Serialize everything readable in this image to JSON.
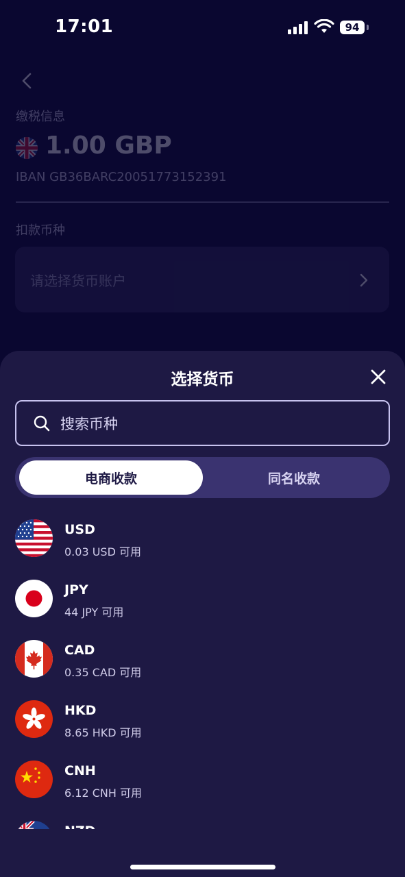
{
  "status_bar": {
    "time": "17:01",
    "battery": "94"
  },
  "background": {
    "tax_label": "缴税信息",
    "amount": "1.00 GBP",
    "iban": "IBAN GB36BARC20051773152391",
    "debit_label": "扣款币种",
    "select_placeholder": "请选择货币账户"
  },
  "sheet": {
    "title": "选择货币",
    "search_placeholder": "搜索币种",
    "tabs": [
      {
        "label": "电商收款",
        "active": true
      },
      {
        "label": "同名收款",
        "active": false
      }
    ],
    "currencies": [
      {
        "code": "USD",
        "available": "0.03 USD 可用",
        "flag": "us-flag-icon"
      },
      {
        "code": "JPY",
        "available": "44 JPY 可用",
        "flag": "jp-flag-icon"
      },
      {
        "code": "CAD",
        "available": "0.35 CAD 可用",
        "flag": "ca-flag-icon"
      },
      {
        "code": "HKD",
        "available": "8.65 HKD 可用",
        "flag": "hk-flag-icon"
      },
      {
        "code": "CNH",
        "available": "6.12 CNH 可用",
        "flag": "cn-flag-icon"
      },
      {
        "code": "NZD",
        "available": "",
        "flag": "nz-flag-icon"
      }
    ]
  },
  "colors": {
    "background": "#0a0730",
    "sheet": "#1e1944",
    "segment_track": "#3a3370",
    "accent_text": "#cfcbe8"
  }
}
